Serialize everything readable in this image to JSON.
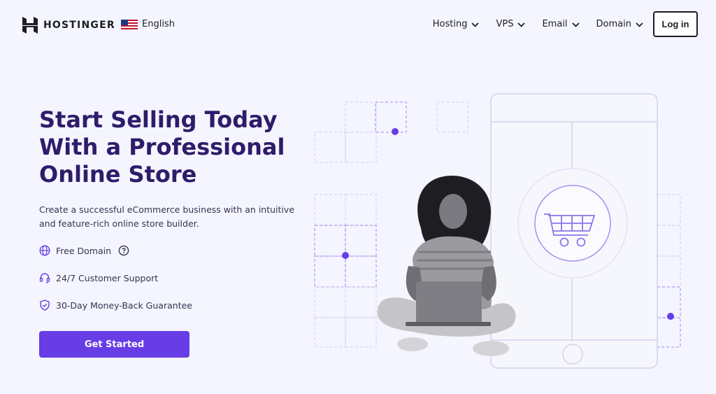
{
  "brand": {
    "name": "HOSTINGER"
  },
  "language": {
    "label": "English",
    "flag": "us-flag-icon"
  },
  "nav": {
    "items": [
      {
        "label": "Hosting"
      },
      {
        "label": "VPS"
      },
      {
        "label": "Email"
      },
      {
        "label": "Domain"
      }
    ],
    "login_label": "Log in"
  },
  "hero": {
    "title_line1": "Start Selling Today",
    "title_line2": "With a Professional",
    "title_line3": "Online Store",
    "subtitle": "Create a successful eCommerce business with an intuitive and feature-rich online store builder.",
    "features": [
      {
        "label": "Free Domain",
        "icon": "globe-icon",
        "help": true
      },
      {
        "label": "24/7 Customer Support",
        "icon": "headset-icon"
      },
      {
        "label": "30-Day Money-Back Guarantee",
        "icon": "shield-check-icon"
      }
    ],
    "cta_label": "Get Started"
  },
  "colors": {
    "accent": "#673de6",
    "heading": "#2f1c6a",
    "background": "#f4f5ff"
  }
}
